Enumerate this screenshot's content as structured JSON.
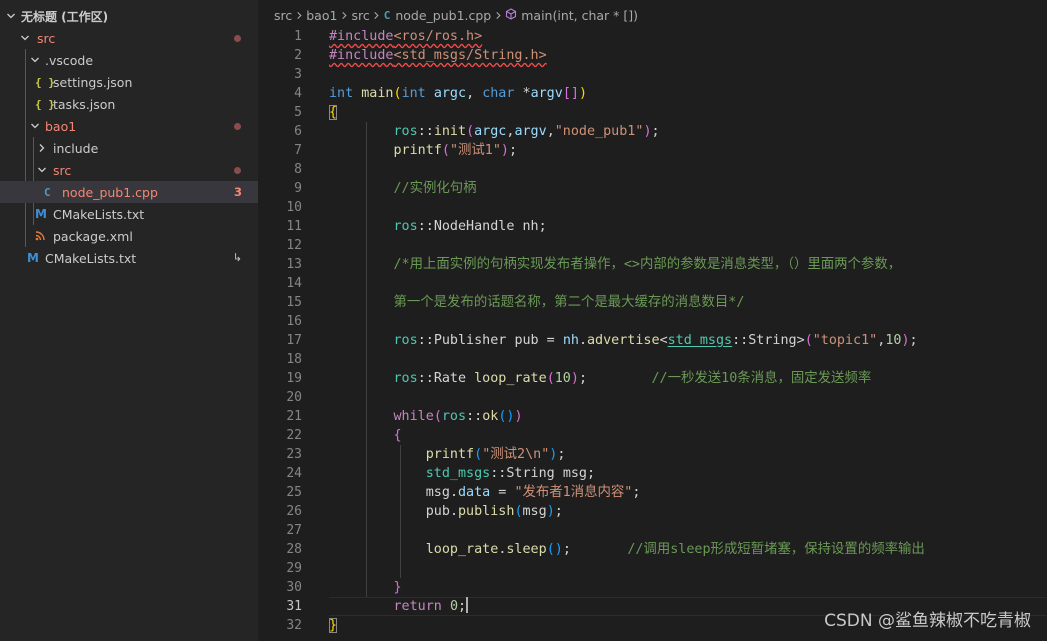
{
  "explorer": {
    "workspace_title": "无标题 (工作区)",
    "items": [
      {
        "label": "src",
        "badge": ""
      },
      {
        "label": ".vscode",
        "badge": ""
      },
      {
        "label": "settings.json",
        "badge": ""
      },
      {
        "label": "tasks.json",
        "badge": ""
      },
      {
        "label": "bao1",
        "badge": ""
      },
      {
        "label": "include",
        "badge": ""
      },
      {
        "label": "src",
        "badge": ""
      },
      {
        "label": "node_pub1.cpp",
        "badge": "3"
      },
      {
        "label": "CMakeLists.txt",
        "badge": ""
      },
      {
        "label": "package.xml",
        "badge": ""
      },
      {
        "label": "CMakeLists.txt",
        "badge": ""
      }
    ],
    "icons": {
      "json": "{ }",
      "cmake": "M",
      "rss": "rss-icon",
      "cpp": "C"
    }
  },
  "breadcrumb": {
    "parts": [
      "src",
      "bao1",
      "src",
      "node_pub1.cpp",
      "main(int, char * [])"
    ],
    "cpp_icon": "C"
  },
  "editor": {
    "line_numbers": [
      "1",
      "2",
      "3",
      "4",
      "5",
      "6",
      "7",
      "8",
      "9",
      "10",
      "11",
      "12",
      "13",
      "14",
      "15",
      "16",
      "17",
      "18",
      "19",
      "20",
      "21",
      "22",
      "23",
      "24",
      "25",
      "26",
      "27",
      "28",
      "29",
      "30",
      "31",
      "32"
    ],
    "current_line": 31,
    "tokens": {
      "include_kw": "#include",
      "include1": "<ros/ros.h>",
      "include2": "<std_msgs/String.h>",
      "int": "int",
      "main": "main",
      "argc": "argc",
      "char": "char",
      "argv": "argv",
      "ros": "ros",
      "init": "init",
      "node_name": "\"node_pub1\"",
      "printf": "printf",
      "str_test1": "\"测试1\"",
      "cmt_instantiate": "//实例化句柄",
      "NodeHandle": "NodeHandle",
      "nh": "nh",
      "cmt_block1": "/*用上面实例的句柄实现发布者操作，<>内部的参数是消息类型，（）里面两个参数，",
      "cmt_block2": "第一个是发布的话题名称，第二个是最大缓存的消息数目*/",
      "Publisher": "Publisher",
      "pub": "pub",
      "advertise": "advertise",
      "std_msgs": "std_msgs",
      "String": "String",
      "topic": "\"topic1\"",
      "num10": "10",
      "Rate": "Rate",
      "loop_rate": "loop_rate",
      "cmt_rate": "//一秒发送10条消息，固定发送频率",
      "while": "while",
      "ok": "ok",
      "str_test2": "\"测试2\\n\"",
      "msg": "msg",
      "data": "data",
      "str_content": "\"发布者1消息内容\"",
      "publish": "publish",
      "sleep": "sleep",
      "cmt_sleep": "//调用sleep形成短暂堵塞，保持设置的频率输出",
      "return": "return",
      "num0": "0"
    }
  },
  "watermark": "CSDN @鲨鱼辣椒不吃青椒",
  "colors": {
    "sidebar_bg": "#252526",
    "editor_bg": "#1e1e1e",
    "selected_bg": "#37373d",
    "error": "#f48771",
    "keyword": "#569cd6",
    "control": "#c586c0",
    "function": "#dcdcaa",
    "type": "#4ec9b0",
    "variable": "#9cdcfe",
    "string": "#ce9178",
    "number": "#b5cea8",
    "comment": "#6a9955"
  }
}
